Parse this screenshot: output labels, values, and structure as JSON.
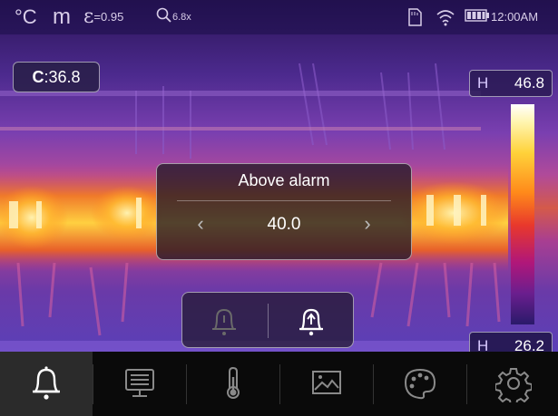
{
  "status_bar": {
    "unit": "°C",
    "mode": "m",
    "emissivity_symbol": "ε",
    "emissivity": "=0.95",
    "zoom": "6.8x",
    "time": "12:00AM"
  },
  "center_temp": {
    "label": "C",
    "value": ":36.8"
  },
  "scale": {
    "high_label": "H",
    "high_value": "46.8",
    "low_label": "H",
    "low_value": "26.2"
  },
  "alarm_dialog": {
    "title": "Above alarm",
    "value": "40.0",
    "left_arrow": "‹",
    "right_arrow": "›"
  },
  "alarm_toggle": {
    "options": [
      "below-alarm-bell-icon",
      "above-alarm-bell-icon"
    ],
    "selected": "above-alarm-bell-icon"
  },
  "bottom_menu": {
    "items": [
      "bell-icon",
      "monitor-icon",
      "thermometer-icon",
      "gallery-icon",
      "palette-icon",
      "gear-icon"
    ],
    "active": "bell-icon"
  },
  "colors": {
    "status_bar_bg": "#1c0e48",
    "menu_bg": "#0a0a0a",
    "menu_active_bg": "#2b2b2b",
    "dialog_bg": "#231928",
    "hot": "#ffd23a",
    "cold": "#2a1a6a"
  }
}
